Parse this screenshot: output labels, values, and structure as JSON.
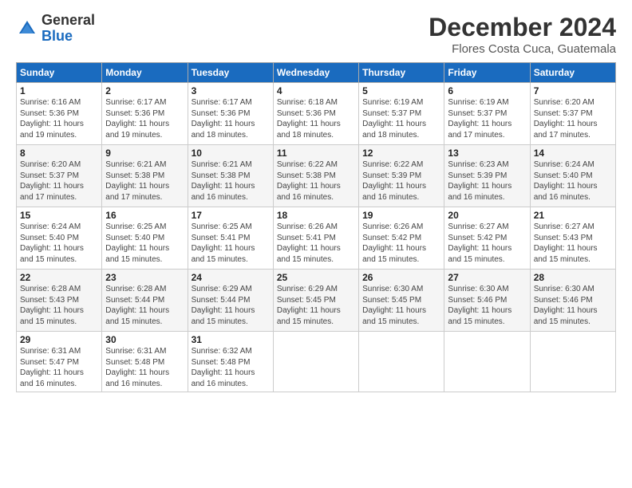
{
  "logo": {
    "general": "General",
    "blue": "Blue"
  },
  "title": "December 2024",
  "subtitle": "Flores Costa Cuca, Guatemala",
  "days_header": [
    "Sunday",
    "Monday",
    "Tuesday",
    "Wednesday",
    "Thursday",
    "Friday",
    "Saturday"
  ],
  "weeks": [
    [
      {
        "day": "1",
        "info": "Sunrise: 6:16 AM\nSunset: 5:36 PM\nDaylight: 11 hours\nand 19 minutes."
      },
      {
        "day": "2",
        "info": "Sunrise: 6:17 AM\nSunset: 5:36 PM\nDaylight: 11 hours\nand 19 minutes."
      },
      {
        "day": "3",
        "info": "Sunrise: 6:17 AM\nSunset: 5:36 PM\nDaylight: 11 hours\nand 18 minutes."
      },
      {
        "day": "4",
        "info": "Sunrise: 6:18 AM\nSunset: 5:36 PM\nDaylight: 11 hours\nand 18 minutes."
      },
      {
        "day": "5",
        "info": "Sunrise: 6:19 AM\nSunset: 5:37 PM\nDaylight: 11 hours\nand 18 minutes."
      },
      {
        "day": "6",
        "info": "Sunrise: 6:19 AM\nSunset: 5:37 PM\nDaylight: 11 hours\nand 17 minutes."
      },
      {
        "day": "7",
        "info": "Sunrise: 6:20 AM\nSunset: 5:37 PM\nDaylight: 11 hours\nand 17 minutes."
      }
    ],
    [
      {
        "day": "8",
        "info": "Sunrise: 6:20 AM\nSunset: 5:37 PM\nDaylight: 11 hours\nand 17 minutes."
      },
      {
        "day": "9",
        "info": "Sunrise: 6:21 AM\nSunset: 5:38 PM\nDaylight: 11 hours\nand 17 minutes."
      },
      {
        "day": "10",
        "info": "Sunrise: 6:21 AM\nSunset: 5:38 PM\nDaylight: 11 hours\nand 16 minutes."
      },
      {
        "day": "11",
        "info": "Sunrise: 6:22 AM\nSunset: 5:38 PM\nDaylight: 11 hours\nand 16 minutes."
      },
      {
        "day": "12",
        "info": "Sunrise: 6:22 AM\nSunset: 5:39 PM\nDaylight: 11 hours\nand 16 minutes."
      },
      {
        "day": "13",
        "info": "Sunrise: 6:23 AM\nSunset: 5:39 PM\nDaylight: 11 hours\nand 16 minutes."
      },
      {
        "day": "14",
        "info": "Sunrise: 6:24 AM\nSunset: 5:40 PM\nDaylight: 11 hours\nand 16 minutes."
      }
    ],
    [
      {
        "day": "15",
        "info": "Sunrise: 6:24 AM\nSunset: 5:40 PM\nDaylight: 11 hours\nand 15 minutes."
      },
      {
        "day": "16",
        "info": "Sunrise: 6:25 AM\nSunset: 5:40 PM\nDaylight: 11 hours\nand 15 minutes."
      },
      {
        "day": "17",
        "info": "Sunrise: 6:25 AM\nSunset: 5:41 PM\nDaylight: 11 hours\nand 15 minutes."
      },
      {
        "day": "18",
        "info": "Sunrise: 6:26 AM\nSunset: 5:41 PM\nDaylight: 11 hours\nand 15 minutes."
      },
      {
        "day": "19",
        "info": "Sunrise: 6:26 AM\nSunset: 5:42 PM\nDaylight: 11 hours\nand 15 minutes."
      },
      {
        "day": "20",
        "info": "Sunrise: 6:27 AM\nSunset: 5:42 PM\nDaylight: 11 hours\nand 15 minutes."
      },
      {
        "day": "21",
        "info": "Sunrise: 6:27 AM\nSunset: 5:43 PM\nDaylight: 11 hours\nand 15 minutes."
      }
    ],
    [
      {
        "day": "22",
        "info": "Sunrise: 6:28 AM\nSunset: 5:43 PM\nDaylight: 11 hours\nand 15 minutes."
      },
      {
        "day": "23",
        "info": "Sunrise: 6:28 AM\nSunset: 5:44 PM\nDaylight: 11 hours\nand 15 minutes."
      },
      {
        "day": "24",
        "info": "Sunrise: 6:29 AM\nSunset: 5:44 PM\nDaylight: 11 hours\nand 15 minutes."
      },
      {
        "day": "25",
        "info": "Sunrise: 6:29 AM\nSunset: 5:45 PM\nDaylight: 11 hours\nand 15 minutes."
      },
      {
        "day": "26",
        "info": "Sunrise: 6:30 AM\nSunset: 5:45 PM\nDaylight: 11 hours\nand 15 minutes."
      },
      {
        "day": "27",
        "info": "Sunrise: 6:30 AM\nSunset: 5:46 PM\nDaylight: 11 hours\nand 15 minutes."
      },
      {
        "day": "28",
        "info": "Sunrise: 6:30 AM\nSunset: 5:46 PM\nDaylight: 11 hours\nand 15 minutes."
      }
    ],
    [
      {
        "day": "29",
        "info": "Sunrise: 6:31 AM\nSunset: 5:47 PM\nDaylight: 11 hours\nand 16 minutes."
      },
      {
        "day": "30",
        "info": "Sunrise: 6:31 AM\nSunset: 5:48 PM\nDaylight: 11 hours\nand 16 minutes."
      },
      {
        "day": "31",
        "info": "Sunrise: 6:32 AM\nSunset: 5:48 PM\nDaylight: 11 hours\nand 16 minutes."
      },
      null,
      null,
      null,
      null
    ]
  ]
}
